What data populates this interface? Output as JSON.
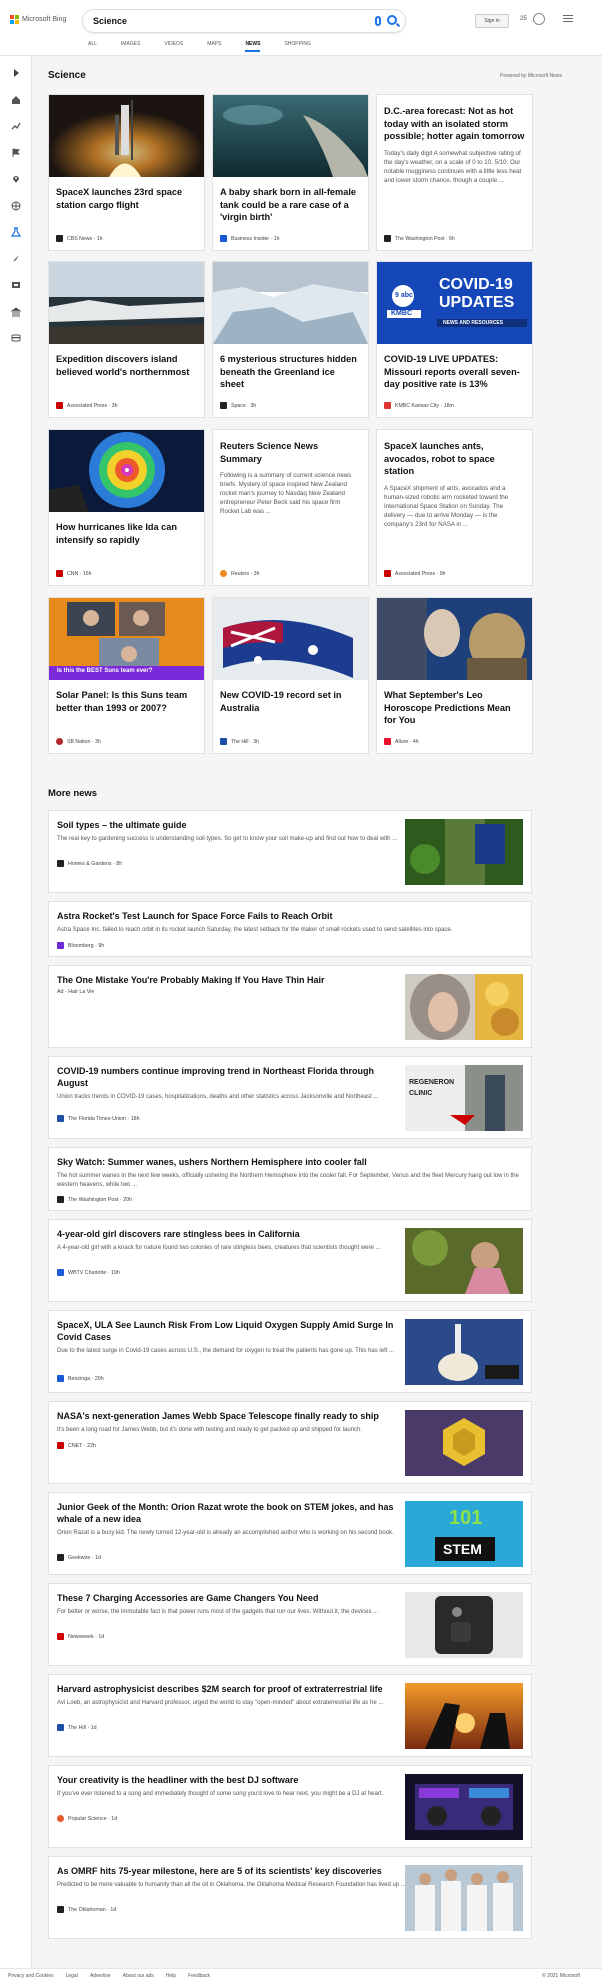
{
  "brand": {
    "name": "Microsoft Bing",
    "logo_colors": [
      "#f25022",
      "#7fba00",
      "#00a4ef",
      "#ffb900"
    ]
  },
  "search": {
    "query": "Science"
  },
  "header": {
    "signin_label": "Sign in",
    "points": "25"
  },
  "tabs": [
    {
      "label": "ALL",
      "active": false
    },
    {
      "label": "IMAGES",
      "active": false
    },
    {
      "label": "VIDEOS",
      "active": false
    },
    {
      "label": "MAPS",
      "active": false
    },
    {
      "label": "NEWS",
      "active": true
    },
    {
      "label": "SHOPPING",
      "active": false
    }
  ],
  "rail_icons": [
    "collapse-icon",
    "home-icon",
    "trending-icon",
    "flag-icon",
    "location-icon",
    "globe-icon",
    "science-icon",
    "rocket-icon",
    "entertainment-icon",
    "government-icon",
    "money-icon"
  ],
  "section": {
    "title": "Science",
    "powered_by": "Powered by Microsoft News"
  },
  "cards": [
    {
      "title": "SpaceX launches 23rd space station cargo flight",
      "snippet": "",
      "provider": "CBS News",
      "time": "1h",
      "provider_color": "#222"
    },
    {
      "title": "A baby shark born in all-female tank could be a rare case of a 'virgin birth'",
      "snippet": "",
      "provider": "Business Insider",
      "time": "1h",
      "provider_color": "#1a5ad8"
    },
    {
      "title": "D.C.-area forecast: Not as hot today with an isolated storm possible; hotter again tomorrow",
      "snippet": "Today's daily digit A somewhat subjective rating of the day's weather, on a scale of 0 to 10. 5/10: Our notable mugginess continues with a little less heat and lower storm chance, though a couple ...",
      "provider": "The Washington Post",
      "time": "6h",
      "provider_color": "#222"
    },
    {
      "title": "Expedition discovers island believed world's northernmost",
      "snippet": "",
      "provider": "Associated Press",
      "time": "3h",
      "provider_color": "#c00"
    },
    {
      "title": "6 mysterious structures hidden beneath the Greenland ice sheet",
      "snippet": "",
      "provider": "Space",
      "time": "3h",
      "provider_color": "#222"
    },
    {
      "title": "COVID-19 LIVE UPDATES: Missouri reports overall seven-day positive rate is 13%",
      "snippet": "",
      "provider": "KMBC Kansas City",
      "time": "18m",
      "provider_color": "#d33"
    },
    {
      "title": "How hurricanes like Ida can intensify so rapidly",
      "snippet": "",
      "provider": "CNN",
      "time": "16h",
      "provider_color": "#c00"
    },
    {
      "title": "Reuters Science News Summary",
      "snippet": "Following is a summary of current science news briefs. Mystery of space inspired New Zealand rocket man's journey to Nasdaq New Zealand entrepreneur Peter Beck said his space firm Rocket Lab was ...",
      "provider": "Reuters",
      "time": "3h",
      "provider_color": "#f08a24"
    },
    {
      "title": "SpaceX launches ants, avocados, robot to space station",
      "snippet": "A SpaceX shipment of ants, avocados and a human-sized robotic arm rocketed toward the International Space Station on Sunday. The delivery — due to arrive Monday — is the company's 23rd for NASA in ...",
      "provider": "Associated Press",
      "time": "9h",
      "provider_color": "#c00"
    },
    {
      "title": "Solar Panel: Is this Suns team better than 1993 or 2007?",
      "snippet": "",
      "provider": "SB Nation",
      "time": "3h",
      "provider_color": "#b2262c"
    },
    {
      "title": "New COVID-19 record set in Australia",
      "snippet": "",
      "provider": "The Hill",
      "time": "3h",
      "provider_color": "#1f4fa8"
    },
    {
      "title": "What September's Leo Horoscope Predictions Mean for You",
      "snippet": "",
      "provider": "Allure",
      "time": "4h",
      "provider_color": "#e8102b"
    }
  ],
  "card_image_overlays": {
    "kmbc_logo": "9 abc",
    "kmbc_text": "KMBC",
    "covid_line1": "COVID-19",
    "covid_line2": "UPDATES",
    "covid_line3": "NEWS AND RESOURCES",
    "suns_banner": "Is this the BEST Suns team ever?"
  },
  "more_news": {
    "title": "More news",
    "items": [
      {
        "title": "Soil types – the ultimate guide",
        "snippet": "The real key to gardening success is understanding soil types. So get to know your soil make-up and find out how to deal with ...",
        "provider": "Homes & Gardens",
        "time": "8h",
        "ad": false,
        "image": "garden",
        "provider_color": "#222"
      },
      {
        "title": "Astra Rocket's Test Launch for Space Force Fails to Reach Orbit",
        "snippet": "Astra Space Inc. failed to reach orbit in its rocket launch Saturday, the latest setback for the maker of small rockets used to send satellites into space.",
        "provider": "Bloomberg",
        "time": "9h",
        "ad": false,
        "image": "",
        "provider_color": "#6b2bd9"
      },
      {
        "title": "The One Mistake You're Probably Making If You Have Thin Hair",
        "snippet": "",
        "provider": "Hair La Vie",
        "time": "",
        "ad": true,
        "ad_label": "Ad",
        "image": "hair",
        "provider_color": ""
      },
      {
        "title": "COVID-19 numbers continue improving trend in Northeast Florida through August",
        "snippet": "Union tracks trends in COVID-19 cases, hospitalizations, deaths and other statistics across Jacksonville and Northeast ...",
        "provider": "The Florida Times-Union",
        "time": "18h",
        "ad": false,
        "image": "clinic",
        "image_text": "REGENERON CLINIC",
        "provider_color": "#1f4fa8"
      },
      {
        "title": "Sky Watch: Summer wanes, ushers Northern Hemisphere into cooler fall",
        "snippet": "The hot summer wanes in the next few weeks, officially ushering the Northern Hemisphere into the cooler fall. For September, Venus and the fleet Mercury hang out low in the western heavens, while two ...",
        "provider": "The Washington Post",
        "time": "20h",
        "ad": false,
        "image": "",
        "provider_color": "#222"
      },
      {
        "title": "4-year-old girl discovers rare stingless bees in California",
        "snippet": "A 4-year-old girl with a knack for nature found two colonies of rare stingless bees, creatures that scientists thought were ...",
        "provider": "WBTV Charlotte",
        "time": "19h",
        "ad": false,
        "image": "girl",
        "provider_color": "#1a5ad8"
      },
      {
        "title": "SpaceX, ULA See Launch Risk From Low Liquid Oxygen Supply Amid Surge In Covid Cases",
        "snippet": "Due to the latest surge in Covid-19 cases across U.S., the demand for oxygen to treat the patients has gone up. This has left ...",
        "provider": "Benzinga",
        "time": "20h",
        "ad": false,
        "image": "rocket",
        "provider_color": "#1a5ad8"
      },
      {
        "title": "NASA's next-generation James Webb Space Telescope finally ready to ship",
        "snippet": "It's been a long road for James Webb, but it's done with testing and ready to get packed up and shipped for launch.",
        "provider": "CNET",
        "time": "22h",
        "ad": false,
        "image": "webb",
        "provider_color": "#c00"
      },
      {
        "title": "Junior Geek of the Month: Orion Razat wrote the book on STEM jokes, and has whale of a new idea",
        "snippet": "Orion Razat is a busy kid. The newly turned 12-year-old is already an accomplished author who is working on his second book.",
        "provider": "Geekwire",
        "time": "1d",
        "ad": false,
        "image": "stem",
        "image_text_1": "101",
        "image_text_2": "STEM",
        "provider_color": "#222"
      },
      {
        "title": "These 7 Charging Accessories are Game Changers You Need",
        "snippet": "For better or worse, the immutable fact is that power runs most of the gadgets that run our lives. Without it, the devices ...",
        "provider": "Newsweek",
        "time": "1d",
        "ad": false,
        "image": "charger",
        "provider_color": "#c00"
      },
      {
        "title": "Harvard astrophysicist describes $2M search for proof of extraterrestrial life",
        "snippet": "Avi Loeb, an astrophysicist and Harvard professor, urged the world to stay \"open-minded\" about extraterrestrial life as he ...",
        "provider": "The Hill",
        "time": "1d",
        "ad": false,
        "image": "telescope",
        "provider_color": "#1f4fa8"
      },
      {
        "title": "Your creativity is the headliner with the best DJ software",
        "snippet": "If you've ever listened to a song and immediately thought of some song you'd love to hear next, you might be a DJ at heart.",
        "provider": "Popular Science",
        "time": "1d",
        "ad": false,
        "image": "dj",
        "provider_color": "#e85a2b"
      },
      {
        "title": "As OMRF hits 75-year milestone, here are 5 of its scientists' key discoveries",
        "snippet": "Predicted to be more valuable to humanity than all the oil in Oklahoma, the Oklahoma Medical Research Foundation has lived up ...",
        "provider": "The Oklahoman",
        "time": "1d",
        "ad": false,
        "image": "lab",
        "provider_color": "#222"
      }
    ]
  },
  "footer": {
    "links": [
      "Privacy and Cookies",
      "Legal",
      "Advertise",
      "About our ads",
      "Help",
      "Feedback"
    ],
    "copyright": "© 2021 Microsoft"
  }
}
